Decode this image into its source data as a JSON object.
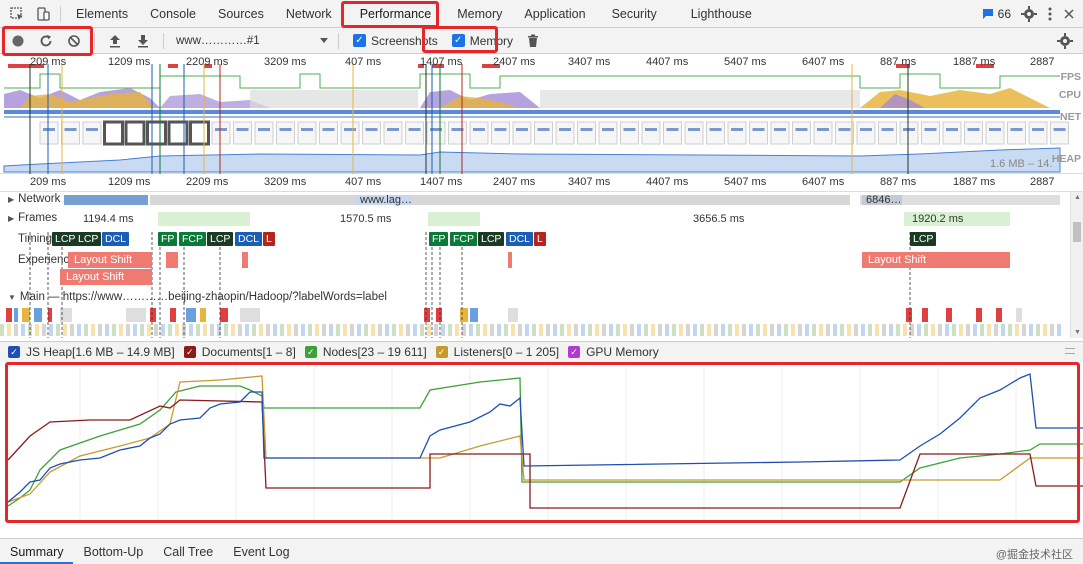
{
  "tabs": {
    "items": [
      "Elements",
      "Console",
      "Sources",
      "Network",
      "Performance",
      "Memory",
      "Application",
      "Security",
      "Lighthouse"
    ],
    "active": "Performance",
    "issues_count": "66"
  },
  "toolbar": {
    "recording": "www…………#1",
    "screenshots_label": "Screenshots",
    "memory_label": "Memory"
  },
  "overview": {
    "ruler": [
      "209 ms",
      "1209 ms",
      "2209 ms",
      "3209 ms",
      "407 ms",
      "1407 ms",
      "2407 ms",
      "3407 ms",
      "4407 ms",
      "5407 ms",
      "6407 ms",
      "887 ms",
      "1887 ms",
      "2887"
    ],
    "fps": "FPS",
    "cpu": "CPU",
    "net": "NET",
    "heap": "HEAP",
    "heap_range": "1.6 MB – 14."
  },
  "ruler2": [
    "209 ms",
    "1209 ms",
    "2209 ms",
    "3209 ms",
    "407 ms",
    "1407 ms",
    "2407 ms",
    "3407 ms",
    "4407 ms",
    "5407 ms",
    "6407 ms",
    "887 ms",
    "1887 ms",
    "2887"
  ],
  "tracks": {
    "network": "Network",
    "network_req1": "www.lag…",
    "network_req2": "6846…",
    "frames": "Frames",
    "frame_times": [
      "1194.4 ms",
      "1570.5 ms",
      "3656.5 ms",
      "1920.2 ms"
    ],
    "timings": "Timings",
    "experience": "Experience",
    "layout_shift": "Layout Shift",
    "main": "Main — https://www…………beijing-zhaopin/Hadoop/?labelWords=label",
    "marks": {
      "fp": "FP",
      "fcp": "FCP",
      "lcp": "LCP",
      "dcl": "DCL",
      "l": "L"
    }
  },
  "legend": {
    "js_heap": "JS Heap[1.6 MB – 14.9 MB]",
    "documents": "Documents[1 – 8]",
    "nodes": "Nodes[23 – 19 611]",
    "listeners": "Listeners[0 – 1 205]",
    "gpu": "GPU Memory"
  },
  "bottom_tabs": [
    "Summary",
    "Bottom-Up",
    "Call Tree",
    "Event Log"
  ],
  "watermark": "@掘金技术社区",
  "colors": {
    "js_heap": "#1f4fb4",
    "documents": "#8b1a1a",
    "nodes": "#3ea03a",
    "listeners": "#c89a2c",
    "gpu": "#b03bd1",
    "highlight": "#e5262a"
  }
}
